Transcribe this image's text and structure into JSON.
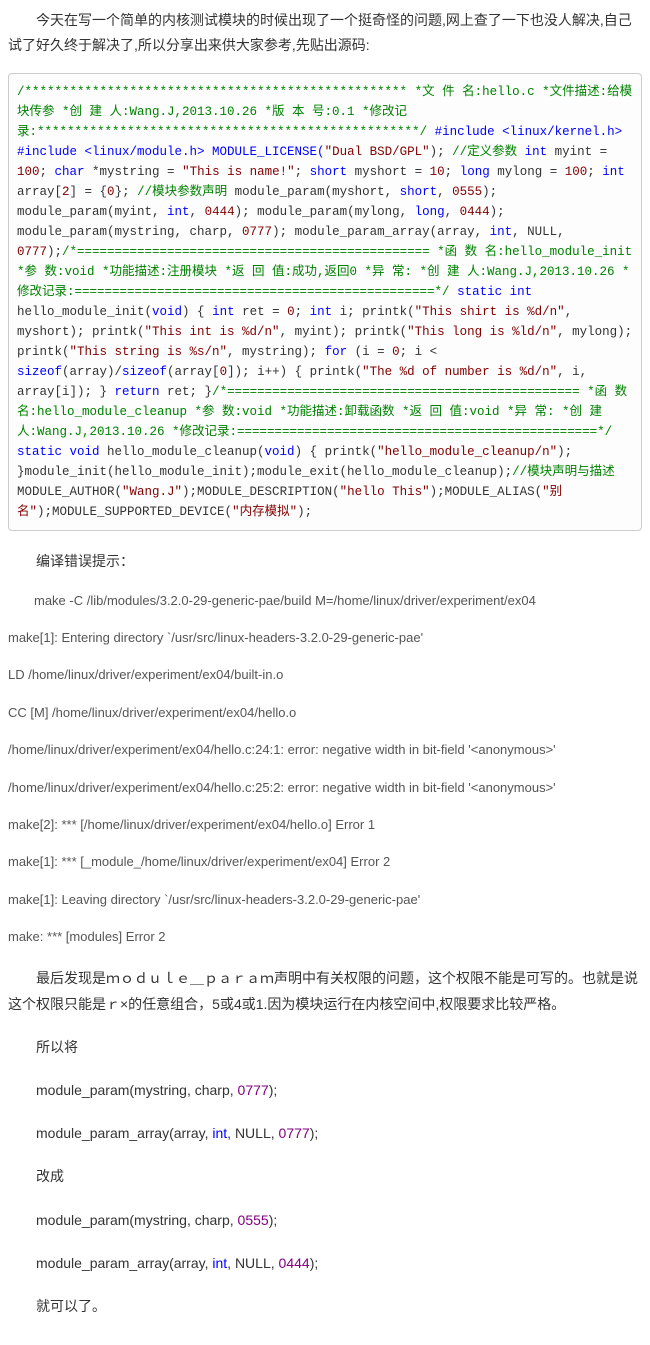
{
  "intro": "今天在写一个简单的内核测试模块的时候出现了一个挺奇怪的问题,网上查了一下也没人解决,自己试了好久终于解决了,所以分享出来供大家参考,先贴出源码:",
  "code": {
    "cm1": "/*************************************************** *文 件 名:hello.c *文件描述:给模块传参 *创 建 人:Wang.J,2013.10.26 *版 本 号:0.1 *修改记录:***************************************************/",
    "kw1": " #include <linux/kernel.h> #include <linux/module.h> MODULE_LICENSE(",
    "st1": "\"Dual BSD/GPL\"",
    "op1": "); ",
    "cm2": "//定义参数",
    "kw2": " int",
    "op2": " myint = ",
    "nu1": "100",
    "op3": "; ",
    "kw3": "char",
    "op4": " *mystring = ",
    "st2": "\"This is name!\"",
    "op5": "; ",
    "kw4": "short",
    "op6": " myshort = ",
    "nu2": "10",
    "op7": "; ",
    "kw5": "long",
    "op8": " mylong = ",
    "nu3": "100",
    "op9": "; ",
    "kw6": "int",
    "op10": " array[",
    "nu4": "2",
    "op11": "] = {",
    "nu5": "0",
    "op12": "}; ",
    "cm3": "//模块参数声明",
    "op13": " module_param(myshort, ",
    "kw7": "short",
    "op14": ", ",
    "nu6": "0555",
    "op15": "); module_param(myint, ",
    "kw8": "int",
    "op16": ", ",
    "nu7": "0444",
    "op17": "); module_param(mylong, ",
    "kw9": "long",
    "op18": ", ",
    "nu8": "0444",
    "op19": "); module_param(mystring, charp, ",
    "nu9": "0777",
    "op20": "); module_param_array(array, ",
    "kw10": "int",
    "op21": ", NULL, ",
    "nu10": "0777",
    "op22": ");",
    "cm4": "/*=============================================== *函 数 名:hello_module_init *参    数:void *功能描述:注册模块 *返 回 值:成功,返回0 *异    常: *创 建 人:Wang.J,2013.10.26 *修改记录:================================================*/",
    "kw11": " static int",
    "op23": " hello_module_init(",
    "kw12": "void",
    "op24": ") {      ",
    "kw13": "int",
    "op25": " ret = ",
    "nu11": "0",
    "op26": ";      ",
    "kw14": "int",
    "op27": " i;      printk(",
    "st3": "\"This shirt is %d/n\"",
    "op28": ", myshort);      printk(",
    "st4": "\"This int is %d/n\"",
    "op29": ", myint);      printk(",
    "st5": "\"This long is %ld/n\"",
    "op30": ", mylong);      printk(",
    "st6": "\"This string is %s/n\"",
    "op31": ", mystring);      ",
    "kw15": "for",
    "op32": " (i = ",
    "nu12": "0",
    "op33": "; i < ",
    "kw16": "sizeof",
    "op34": "(array)/",
    "kw17": "sizeof",
    "op35": "(array[",
    "nu13": "0",
    "op36": "]); i++) {          printk(",
    "st7": "\"The %d of number is %d/n\"",
    "op37": ", i, array[i]);      }      ",
    "kw18": "return",
    "op38": " ret; }",
    "cm5": "/*=============================================== *函 数 名:hello_module_cleanup *参    数:void *功能描述:卸载函数 *返 回 值:void *异    常: *创 建 人:Wang.J,2013.10.26 *修改记录:================================================*/",
    "kw19": " static void",
    "op39": " hello_module_cleanup(",
    "kw20": "void",
    "op40": ") {     printk(",
    "st8": "\"hello_module_cleanup/n\"",
    "op41": "); }module_init(hello_module_init);module_exit(hello_module_cleanup);",
    "cm6": "//模块声明与描述",
    "op42": "MODULE_AUTHOR(",
    "st9": "\"Wang.J\"",
    "op43": ");MODULE_DESCRIPTION(",
    "st10": "\"hello This\"",
    "op44": ");MODULE_ALIAS(",
    "st11": "\"别名\"",
    "op45": ");MODULE_SUPPORTED_DEVICE(",
    "st12": "\"内存模拟\"",
    "op46": ");"
  },
  "compileTitle": "编译错误提示：",
  "errors": [
    "make -C /lib/modules/3.2.0-29-generic-pae/build M=/home/linux/driver/experiment/ex04",
    "make[1]: Entering directory `/usr/src/linux-headers-3.2.0-29-generic-pae'",
    "  LD      /home/linux/driver/experiment/ex04/built-in.o",
    "  CC [M]  /home/linux/driver/experiment/ex04/hello.o",
    "/home/linux/driver/experiment/ex04/hello.c:24:1: error: negative width in bit-field '<anonymous>'",
    "/home/linux/driver/experiment/ex04/hello.c:25:2: error: negative width in bit-field '<anonymous>'",
    "make[2]: *** [/home/linux/driver/experiment/ex04/hello.o] Error 1",
    "make[1]: *** [_module_/home/linux/driver/experiment/ex04] Error 2",
    "make[1]: Leaving directory `/usr/src/linux-headers-3.2.0-29-generic-pae'",
    "make: *** [modules] Error 2"
  ],
  "explain": "最后发现是ｍｏｄｕｌｅ＿ｐａｒａｍ声明中有关权限的问题，这个权限不能是可写的。也就是说这个权限只能是ｒ×的任意组合，5或4或1.因为模块运行在内核空间中,权限要求比较严格。",
  "so": "所以将",
  "fix1a": "module_param(mystring, charp, ",
  "fix1b": "0777",
  "fix1c": ");",
  "fix2a": "module_param_array(array, ",
  "fix2b": "int",
  "fix2c": ", NULL, ",
  "fix2d": "0777",
  "fix2e": ");",
  "change": "改成",
  "fix3a": "module_param(mystring, charp, ",
  "fix3b": "0555",
  "fix3c": ");",
  "fix4a": "module_param_array(array, ",
  "fix4b": "int",
  "fix4c": ", NULL, ",
  "fix4d": "0444",
  "fix4e": ");",
  "done": "就可以了。"
}
